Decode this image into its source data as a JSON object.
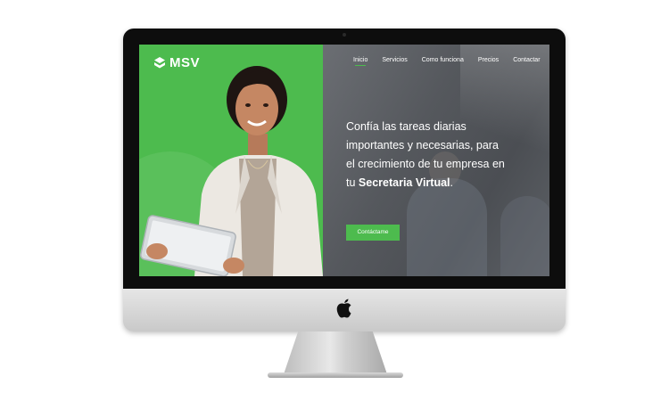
{
  "brand": {
    "name": "MSV",
    "logo_icon": "msv-logo-icon",
    "accent_color": "#4dbb4e"
  },
  "nav": {
    "items": [
      {
        "label": "Inicio",
        "active": true
      },
      {
        "label": "Servicios",
        "active": false
      },
      {
        "label": "Como funciona",
        "active": false
      },
      {
        "label": "Precios",
        "active": false
      },
      {
        "label": "Contactar",
        "active": false
      }
    ]
  },
  "hero": {
    "line1": "Confía las tareas diarias",
    "line2": "importantes y necesarias, para",
    "line3": "el crecimiento de tu empresa en",
    "line4_prefix": "tu ",
    "line4_strong": "Secretaria Virtual",
    "line4_suffix": ".",
    "cta_label": "Contáctame"
  },
  "device": {
    "logo_icon": "apple-logo-icon"
  }
}
